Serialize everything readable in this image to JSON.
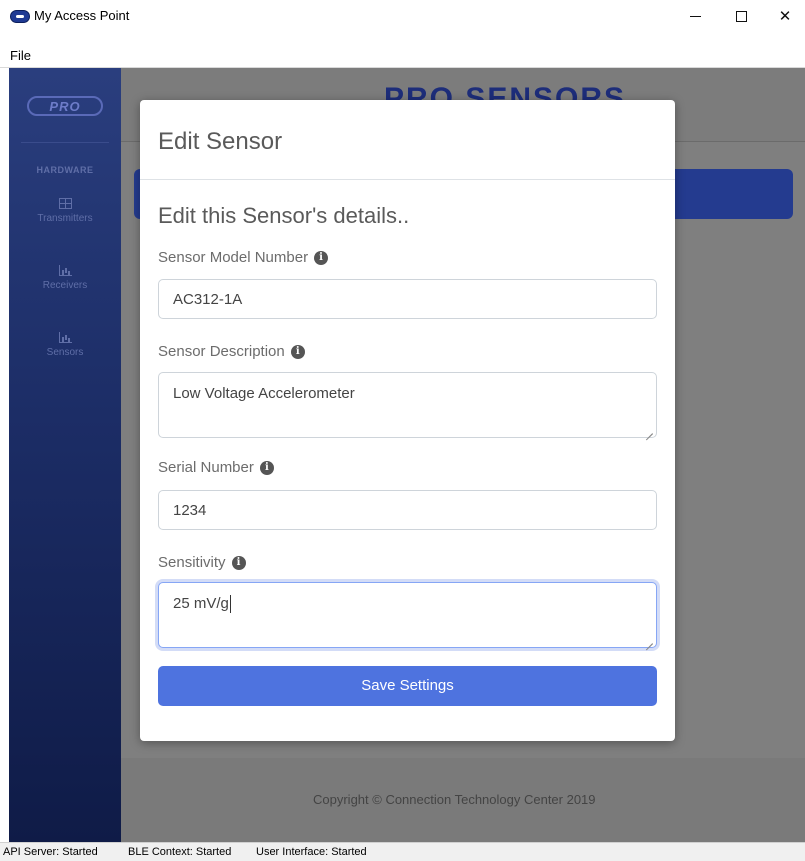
{
  "window": {
    "title": "My Access Point",
    "menu": [
      "File"
    ]
  },
  "sidebar": {
    "logo_text": "PRO",
    "section_title": "HARDWARE",
    "items": [
      {
        "label": "Transmitters",
        "icon": "grid-icon"
      },
      {
        "label": "Receivers",
        "icon": "chart-icon"
      },
      {
        "label": "Sensors",
        "icon": "chart-icon"
      }
    ]
  },
  "header": {
    "brand": "PRO SENSORS"
  },
  "modal": {
    "title": "Edit Sensor",
    "subtitle": "Edit this Sensor's details..",
    "fields": {
      "model_number": {
        "label": "Sensor Model Number",
        "value": "AC312-1A"
      },
      "description": {
        "label": "Sensor Description",
        "value": "Low Voltage Accelerometer"
      },
      "serial_number": {
        "label": "Serial Number",
        "value": "1234"
      },
      "sensitivity": {
        "label": "Sensitivity",
        "value": "25 mV/g"
      }
    },
    "save_label": "Save Settings",
    "info_glyph": "i"
  },
  "footer": {
    "copyright": "Copyright © Connection Technology Center 2019"
  },
  "status": {
    "api": "API Server: Started",
    "ble": "BLE Context: Started",
    "ui": "User Interface: Started"
  },
  "colors": {
    "primary": "#4e73df",
    "sidebar": "#1c2d66",
    "brand": "#1d2d7a"
  }
}
